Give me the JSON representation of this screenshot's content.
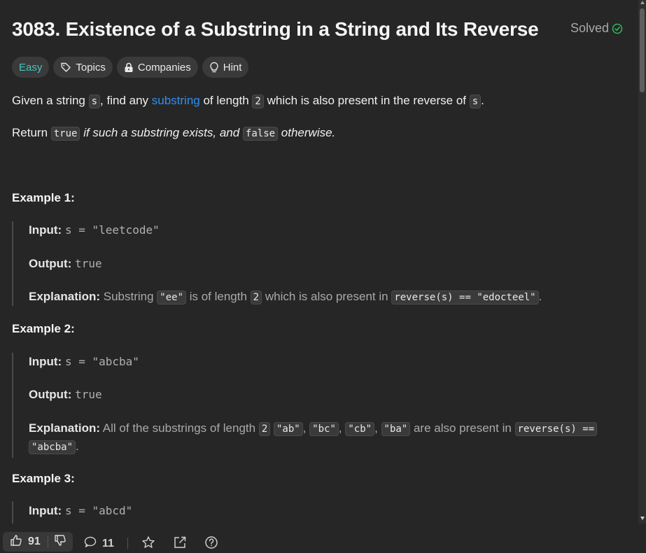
{
  "problem": {
    "title": "3083. Existence of a Substring in a String and Its Reverse",
    "status": "Solved"
  },
  "tags": [
    {
      "label": "Easy",
      "icon": ""
    },
    {
      "label": "Topics",
      "icon": "tag-icon"
    },
    {
      "label": "Companies",
      "icon": "lock-icon"
    },
    {
      "label": "Hint",
      "icon": "lightbulb-icon"
    }
  ],
  "description": {
    "p1": {
      "t1": "Given a string ",
      "c1": "s",
      "t2": ", find any ",
      "link": "substring",
      "t3": " of length ",
      "c2": "2",
      "t4": " which is also present in the reverse of ",
      "c3": "s",
      "t5": "."
    },
    "p2": {
      "t1": "Return ",
      "c1": "true",
      "t2": " if such a substring exists, and ",
      "c2": "false",
      "t3": " otherwise."
    }
  },
  "examples": [
    {
      "heading": "Example 1:",
      "input_label": "Input:",
      "input": "s = \"leetcode\"",
      "output_label": "Output:",
      "output": "true",
      "explanation_label": "Explanation:",
      "e1": " Substring ",
      "ec1": "\"ee\"",
      "e2": " is of length ",
      "ec2": "2",
      "e3": " which is also present in ",
      "ec3": "reverse(s) == \"edocteel\"",
      "e4": "."
    },
    {
      "heading": "Example 2:",
      "input_label": "Input:",
      "input": "s = \"abcba\"",
      "output_label": "Output:",
      "output": "true",
      "explanation_label": "Explanation:",
      "e1": " All of the substrings of length ",
      "ec1": "2",
      "ec2": "\"ab\"",
      "ec3": "\"bc\"",
      "ec4": "\"cb\"",
      "ec5": "\"ba\"",
      "e2": " are also present in ",
      "ec6": "reverse(s) ==",
      "ec7": "\"abcba\"",
      "e3": "."
    },
    {
      "heading": "Example 3:",
      "input_label": "Input:",
      "input": "s = \"abcd\""
    }
  ],
  "footer": {
    "likes": "91",
    "comments": "11"
  },
  "colors": {
    "background": "#262626",
    "easy": "#46c6c2",
    "link": "#2f8ff0",
    "solved_check": "#2cbb5d"
  }
}
